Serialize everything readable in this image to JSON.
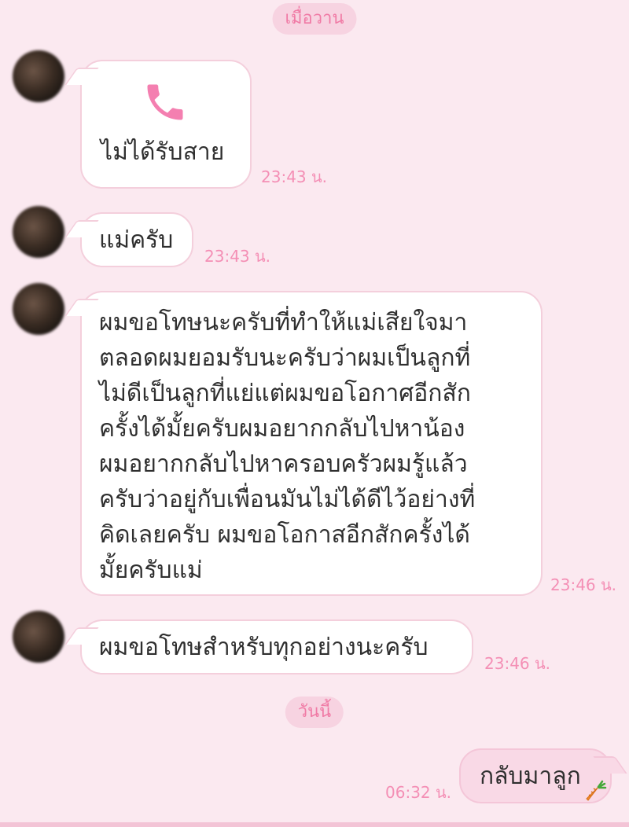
{
  "dates": {
    "yesterday": "เมื่อวาน",
    "today": "วันนี้"
  },
  "messages": [
    {
      "type": "call",
      "icon": "phone-icon",
      "text": "ไม่ได้รับสาย",
      "time": "23:43 น."
    },
    {
      "type": "text",
      "text": "แม่ครับ",
      "time": "23:43 น."
    },
    {
      "type": "text",
      "lines": [
        "ผมขอโทษนะครับที่ทำให้แม่เสียใจมา",
        "ตลอดผมยอมรับนะครับว่าผมเป็นลูกที่",
        "ไม่ดีเป็นลูกที่แย่แต่ผมขอโอกาศอีกสัก",
        "ครั้งได้มั้ยครับผมอยากกลับไปหาน้อง",
        "ผมอยากกลับไปหาครอบครัวผมรู้แล้ว",
        "ครับว่าอยู่กับเพื่อนมันไม่ได้ดีไว้อย่างที่",
        "คิดเลยครับ ผมขอโอกาสอีกสักครั้งได้",
        "มั้ยครับแม่"
      ],
      "time": "23:46 น."
    },
    {
      "type": "text",
      "text": "ผมขอโทษสำหรับทุกอย่างนะครับ",
      "time": "23:46 น."
    }
  ],
  "outgoing": {
    "text": "กลับมาลูก",
    "time": "06:32 น.",
    "sticker": "carrot-icon"
  },
  "colors": {
    "background": "#fbe9f0",
    "accent": "#f07aa5",
    "bubble_out": "#f9d9e6"
  }
}
